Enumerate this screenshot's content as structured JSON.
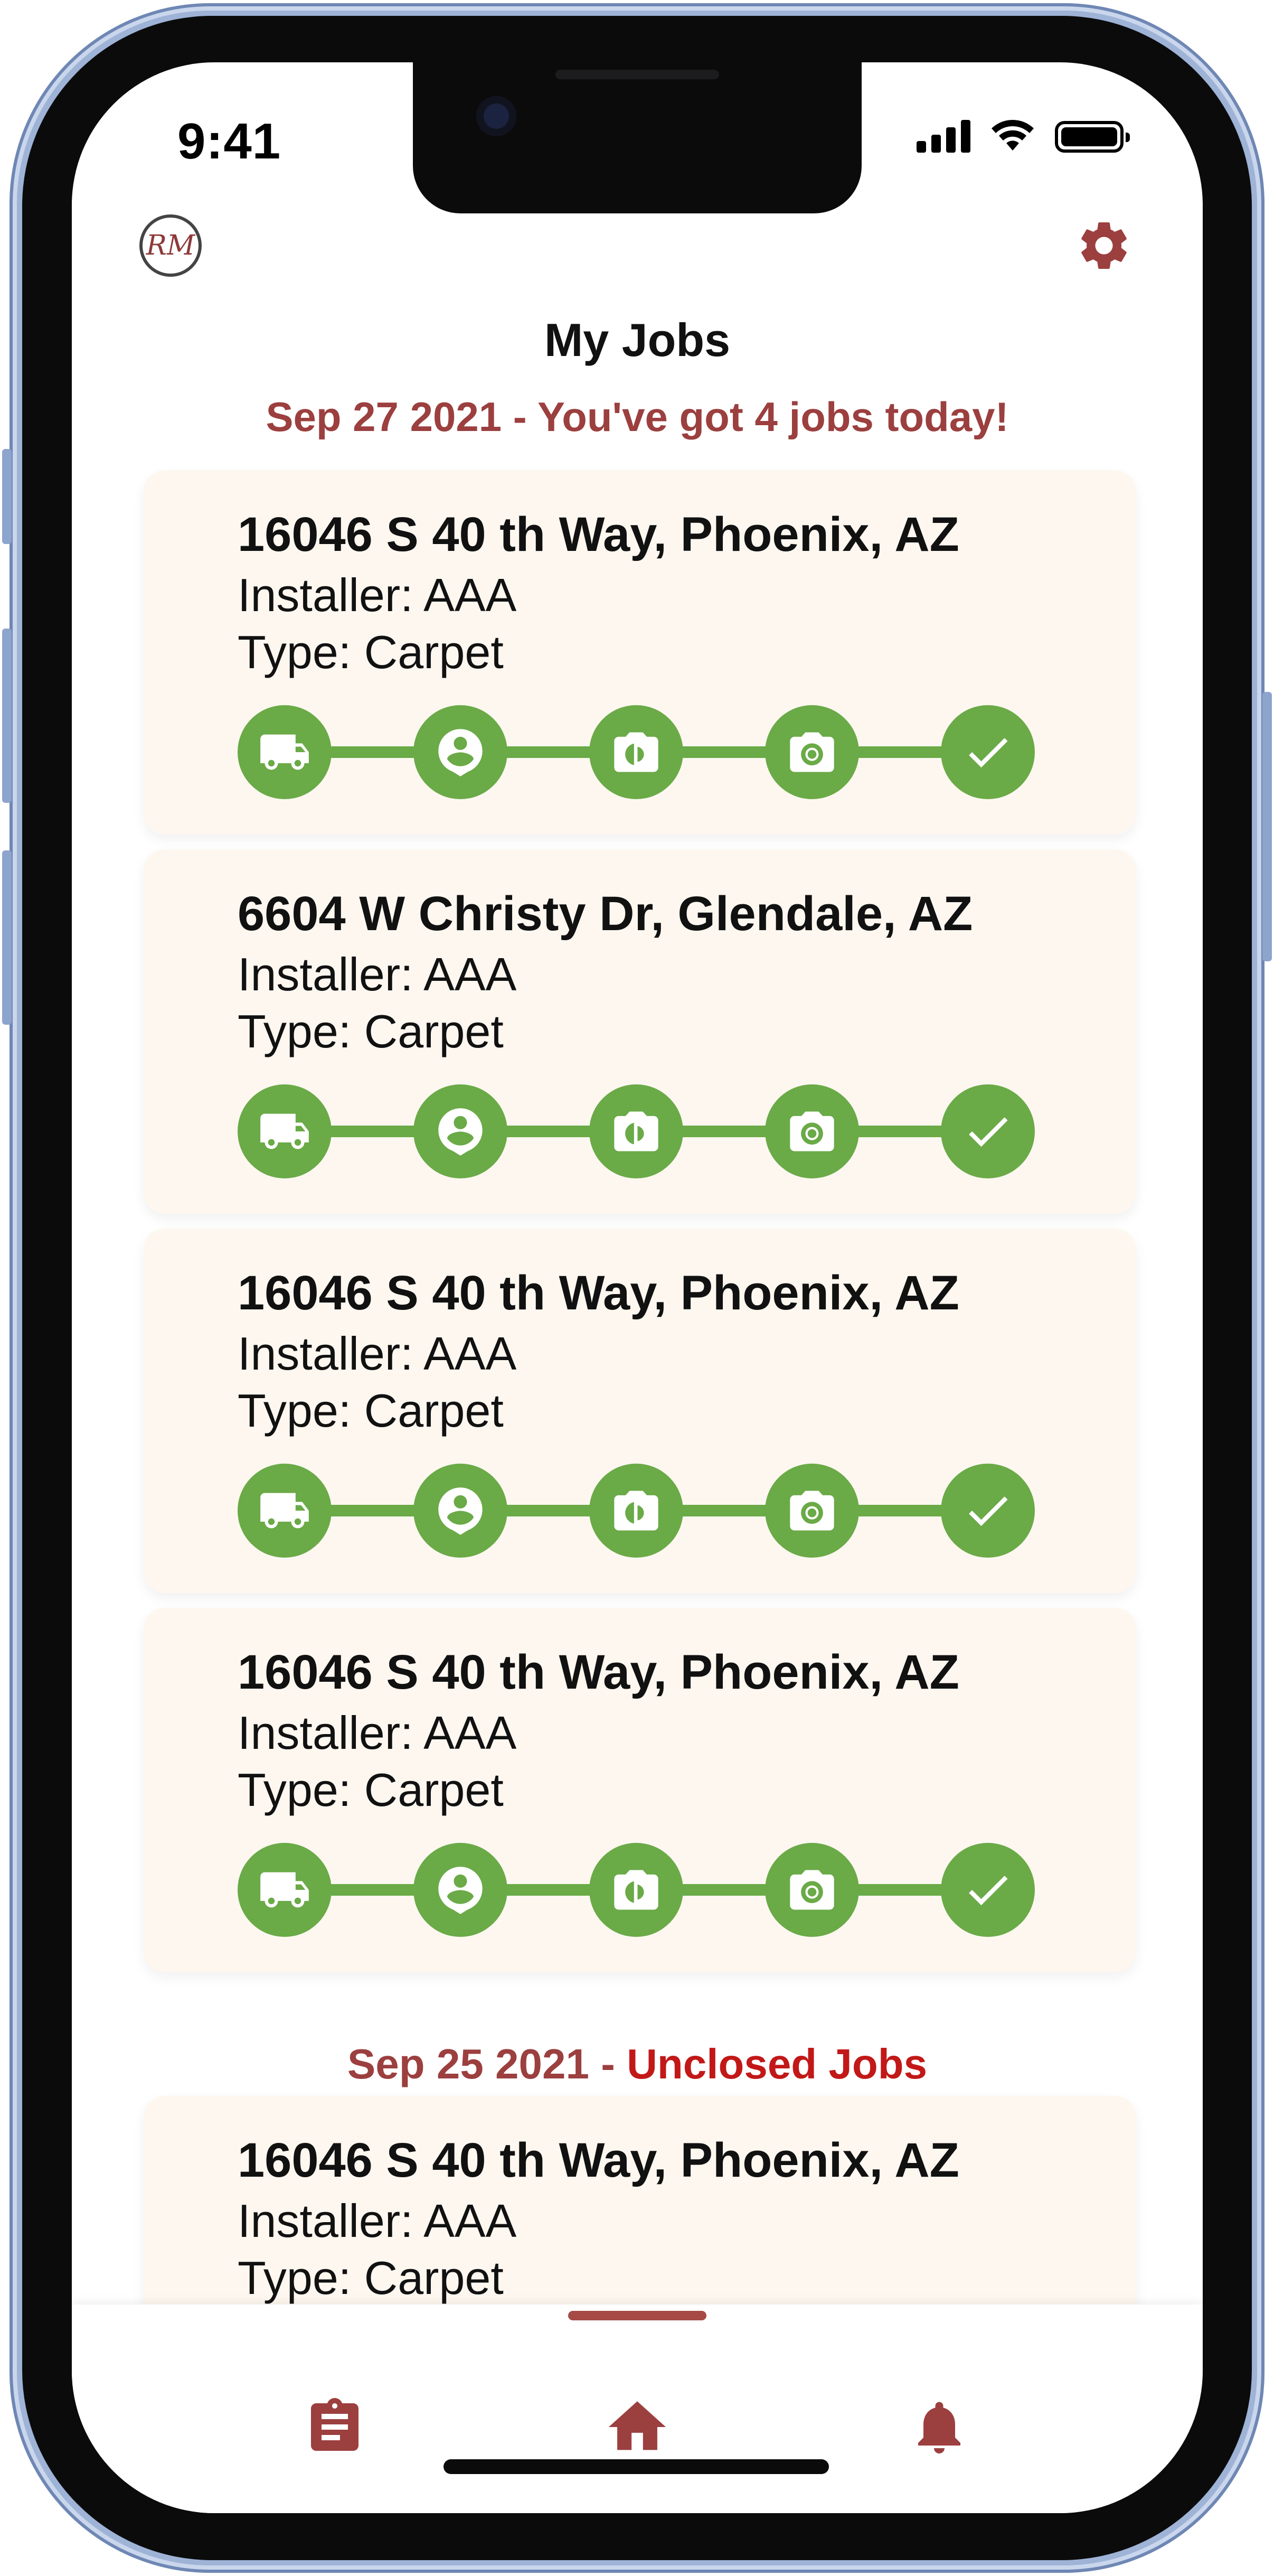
{
  "status_bar": {
    "time": "9:41"
  },
  "header": {
    "logo_text": "RM",
    "title": "My Jobs",
    "today_summary": "Sep 27 2021 - You've got 4 jobs today!"
  },
  "colors": {
    "brand": "#9c3f3f",
    "step_complete": "#6aaa47",
    "card_bg": "#fdf7f0",
    "unclosed": "#c21818"
  },
  "steps": [
    {
      "icon": "truck-icon",
      "status": "complete"
    },
    {
      "icon": "person-pin-icon",
      "status": "complete"
    },
    {
      "icon": "before-photo-icon",
      "status": "complete"
    },
    {
      "icon": "camera-icon",
      "status": "complete"
    },
    {
      "icon": "checkmark-icon",
      "status": "complete"
    }
  ],
  "jobs_today": [
    {
      "address": "16046 S 40 th Way, Phoenix, AZ",
      "installer": "Installer: AAA",
      "type": "Type: Carpet"
    },
    {
      "address": "6604 W Christy Dr, Glendale, AZ",
      "installer": "Installer: AAA",
      "type": "Type: Carpet"
    },
    {
      "address": "16046 S 40 th Way, Phoenix, AZ",
      "installer": "Installer: AAA",
      "type": "Type: Carpet"
    },
    {
      "address": "16046 S 40 th Way, Phoenix, AZ",
      "installer": "Installer: AAA",
      "type": "Type: Carpet"
    }
  ],
  "unclosed_section": {
    "date": "Sep 25 2021 - ",
    "label": "Unclosed Jobs"
  },
  "jobs_unclosed": [
    {
      "address": "16046 S 40 th Way, Phoenix, AZ",
      "installer": "Installer: AAA",
      "type": "Type: Carpet"
    }
  ],
  "bottom_nav": [
    {
      "icon": "clipboard-icon",
      "active": false
    },
    {
      "icon": "home-icon",
      "active": true
    },
    {
      "icon": "bell-icon",
      "active": false
    }
  ]
}
